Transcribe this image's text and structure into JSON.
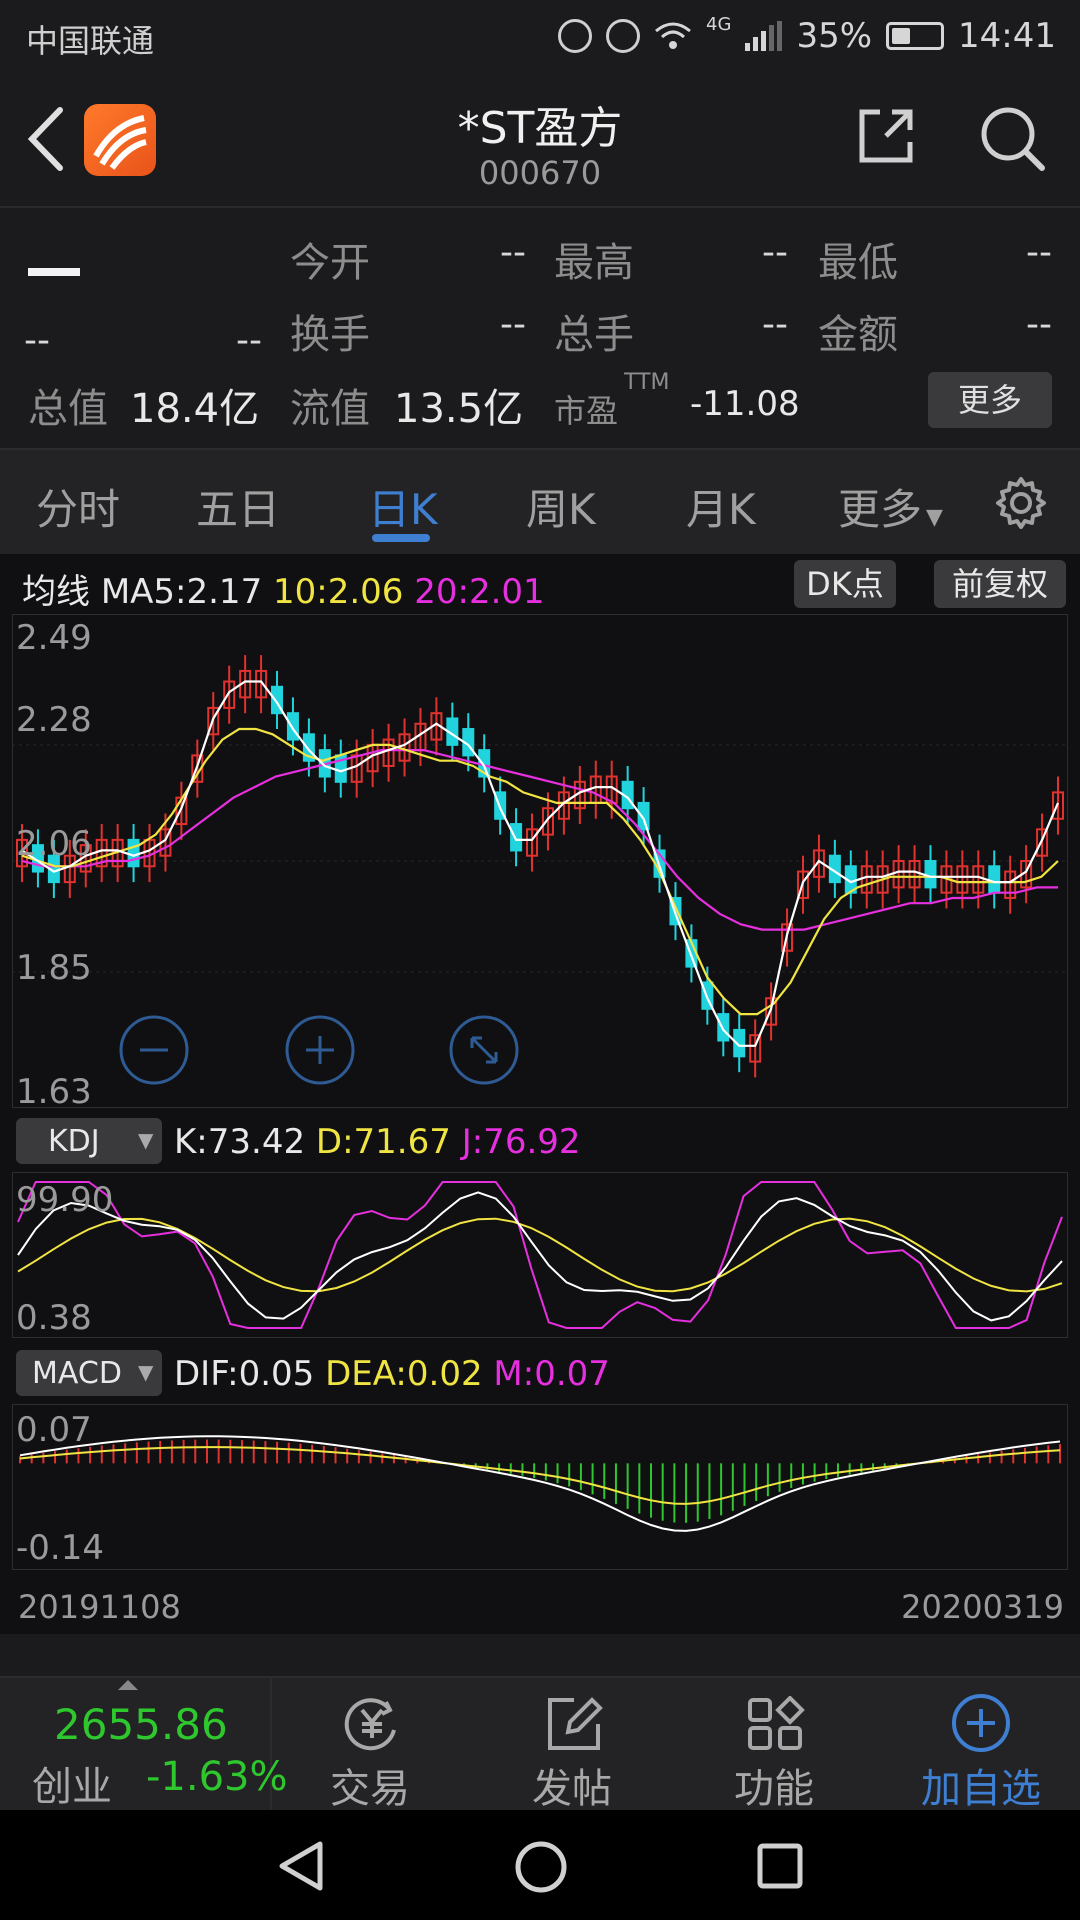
{
  "status_bar": {
    "carrier": "中国联通",
    "battery": "35%",
    "time": "14:41",
    "network": "4G"
  },
  "header": {
    "title": "*ST盈方",
    "code": "000670"
  },
  "quote": {
    "price": "--",
    "change": "--",
    "change_pct": "--",
    "open_label": "今开",
    "open": "--",
    "high_label": "最高",
    "high": "--",
    "low_label": "最低",
    "low": "--",
    "turnover_label": "换手",
    "turnover": "--",
    "volume_label": "总手",
    "volume": "--",
    "amount_label": "金额",
    "amount": "--",
    "mktcap_label": "总值",
    "mktcap": "18.4亿",
    "float_label": "流值",
    "float": "13.5亿",
    "pe_label": "市盈",
    "pe_sup": "TTM",
    "pe": "-11.08",
    "more_button": "更多"
  },
  "tabs": [
    {
      "label": "分时"
    },
    {
      "label": "五日"
    },
    {
      "label": "日K"
    },
    {
      "label": "周K"
    },
    {
      "label": "月K"
    },
    {
      "label": "更多"
    }
  ],
  "active_tab": "日K",
  "ma_legend": {
    "prefix": "均线",
    "ma5": "MA5:2.17",
    "ma10": "10:2.06",
    "ma20": "20:2.01"
  },
  "buttons": {
    "dk": "DK点",
    "adjust": "前复权"
  },
  "kdj": {
    "selector": "KDJ",
    "k": "K:73.42",
    "d": "D:71.67",
    "j": "J:76.92"
  },
  "macd": {
    "selector": "MACD",
    "dif": "DIF:0.05",
    "dea": "DEA:0.02",
    "m": "M:0.07"
  },
  "colors": {
    "up": "#e0332f",
    "down": "#21d3dc",
    "ma5": "#ffffff",
    "ma10": "#f0e443",
    "ma20": "#e62fdf",
    "accent": "#3f7fd1",
    "green": "#2ec82e"
  },
  "chart_data": [
    {
      "type": "candlestick",
      "title": "",
      "y_ticks": [
        "2.49",
        "2.28",
        "2.06",
        "1.85",
        "1.63"
      ],
      "ylim": [
        1.63,
        2.49
      ],
      "x_start": "20191108",
      "x_end": "20200319",
      "series": [
        {
          "name": "MA5",
          "last": 2.17
        },
        {
          "name": "MA10",
          "last": 2.06
        },
        {
          "name": "MA20",
          "last": 2.01
        }
      ],
      "ma5": [
        2.08,
        2.06,
        2.04,
        2.05,
        2.07,
        2.08,
        2.08,
        2.07,
        2.08,
        2.1,
        2.16,
        2.24,
        2.33,
        2.38,
        2.4,
        2.4,
        2.36,
        2.31,
        2.27,
        2.24,
        2.23,
        2.24,
        2.26,
        2.27,
        2.28,
        2.3,
        2.32,
        2.3,
        2.28,
        2.24,
        2.16,
        2.1,
        2.1,
        2.14,
        2.17,
        2.19,
        2.2,
        2.2,
        2.18,
        2.14,
        2.05,
        1.96,
        1.88,
        1.8,
        1.74,
        1.71,
        1.71,
        1.78,
        1.92,
        2.02,
        2.06,
        2.04,
        2.02,
        2.03,
        2.03,
        2.04,
        2.04,
        2.03,
        2.03,
        2.03,
        2.03,
        2.02,
        2.02,
        2.04,
        2.1,
        2.17
      ],
      "ma10": [
        2.07,
        2.06,
        2.05,
        2.05,
        2.06,
        2.07,
        2.08,
        2.09,
        2.11,
        2.15,
        2.2,
        2.25,
        2.29,
        2.31,
        2.31,
        2.3,
        2.28,
        2.26,
        2.25,
        2.26,
        2.27,
        2.28,
        2.28,
        2.27,
        2.26,
        2.25,
        2.25,
        2.24,
        2.22,
        2.21,
        2.19,
        2.18,
        2.17,
        2.17,
        2.17,
        2.17,
        2.14,
        2.1,
        2.05,
        1.98,
        1.91,
        1.84,
        1.8,
        1.77,
        1.77,
        1.79,
        1.83,
        1.89,
        1.95,
        1.99,
        2.01,
        2.02,
        2.03,
        2.03,
        2.03,
        2.03,
        2.02,
        2.02,
        2.02,
        2.02,
        2.02,
        2.03,
        2.06
      ],
      "ma20": [
        2.06,
        2.05,
        2.05,
        2.05,
        2.06,
        2.06,
        2.07,
        2.09,
        2.12,
        2.15,
        2.18,
        2.2,
        2.22,
        2.23,
        2.24,
        2.25,
        2.26,
        2.27,
        2.27,
        2.27,
        2.26,
        2.25,
        2.24,
        2.23,
        2.22,
        2.21,
        2.2,
        2.19,
        2.17,
        2.13,
        2.08,
        2.03,
        1.99,
        1.96,
        1.94,
        1.93,
        1.93,
        1.93,
        1.94,
        1.95,
        1.96,
        1.97,
        1.98,
        1.98,
        1.99,
        1.99,
        2.0,
        2.0,
        2.01,
        2.01
      ]
    },
    {
      "type": "line",
      "title": "",
      "y_ticks": [
        "99.90",
        "0.38"
      ],
      "ylim": [
        0.38,
        99.9
      ],
      "series": [
        {
          "name": "K",
          "last": 73.42
        },
        {
          "name": "D",
          "last": 71.67
        },
        {
          "name": "J",
          "last": 76.92
        }
      ]
    },
    {
      "type": "bar",
      "title": "",
      "y_ticks": [
        "0.07",
        "-0.14"
      ],
      "ylim": [
        -0.14,
        0.07
      ],
      "series": [
        {
          "name": "DIF",
          "last": 0.05
        },
        {
          "name": "DEA",
          "last": 0.02
        },
        {
          "name": "M",
          "last": 0.07
        }
      ]
    }
  ],
  "bottom_index": {
    "value": "2655.86",
    "name": "创业",
    "change": "-1.63%"
  },
  "bottom_nav": [
    {
      "label": "交易"
    },
    {
      "label": "发帖"
    },
    {
      "label": "功能"
    },
    {
      "label": "加自选"
    }
  ]
}
